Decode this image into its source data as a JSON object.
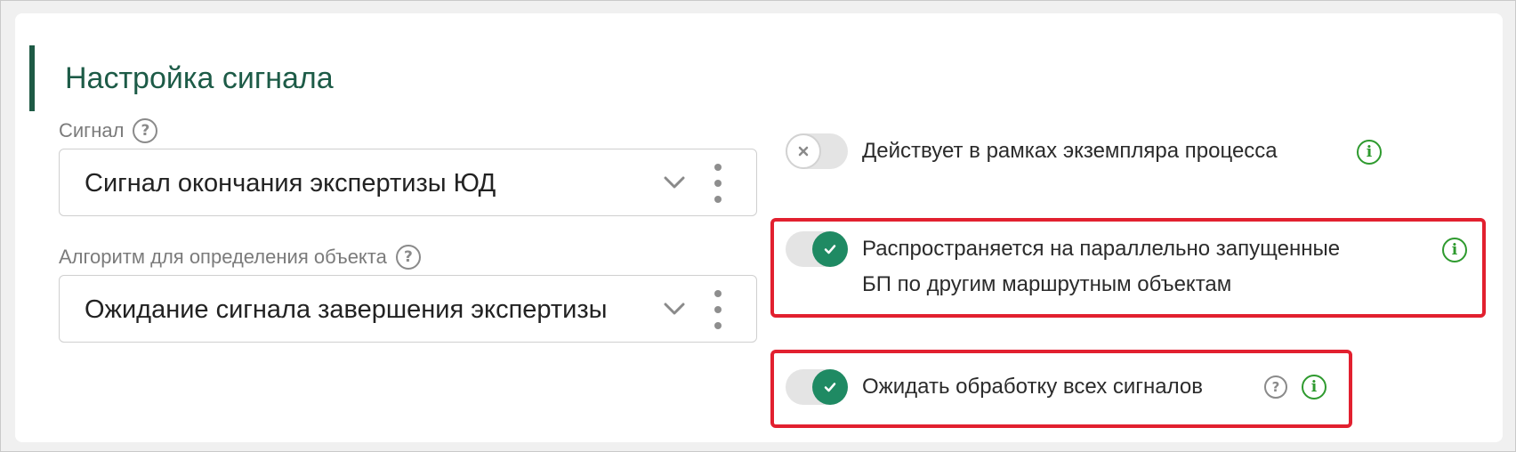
{
  "section": {
    "title": "Настройка сигнала"
  },
  "fields": {
    "signal": {
      "label": "Сигнал",
      "value": "Сигнал окончания экспертизы ЮД"
    },
    "algorithm": {
      "label": "Алгоритм для определения объекта",
      "value": "Ожидание сигнала завершения экспертизы"
    }
  },
  "toggles": [
    {
      "label": "Действует в рамках экземпляра процесса",
      "state": "off"
    },
    {
      "label_line1": "Распространяется на параллельно запущенные",
      "label_line2": "БП по другим маршрутным объектам",
      "state": "on"
    },
    {
      "label": "Ожидать обработку всех сигналов",
      "state": "on"
    }
  ],
  "icons": {
    "help": "?",
    "info": "i",
    "check": "✓",
    "cross": "×"
  },
  "colors": {
    "accent": "#1d5b47",
    "toggle_on": "#1f8a63",
    "info": "#2e9a2e",
    "highlight": "#e2202f"
  }
}
